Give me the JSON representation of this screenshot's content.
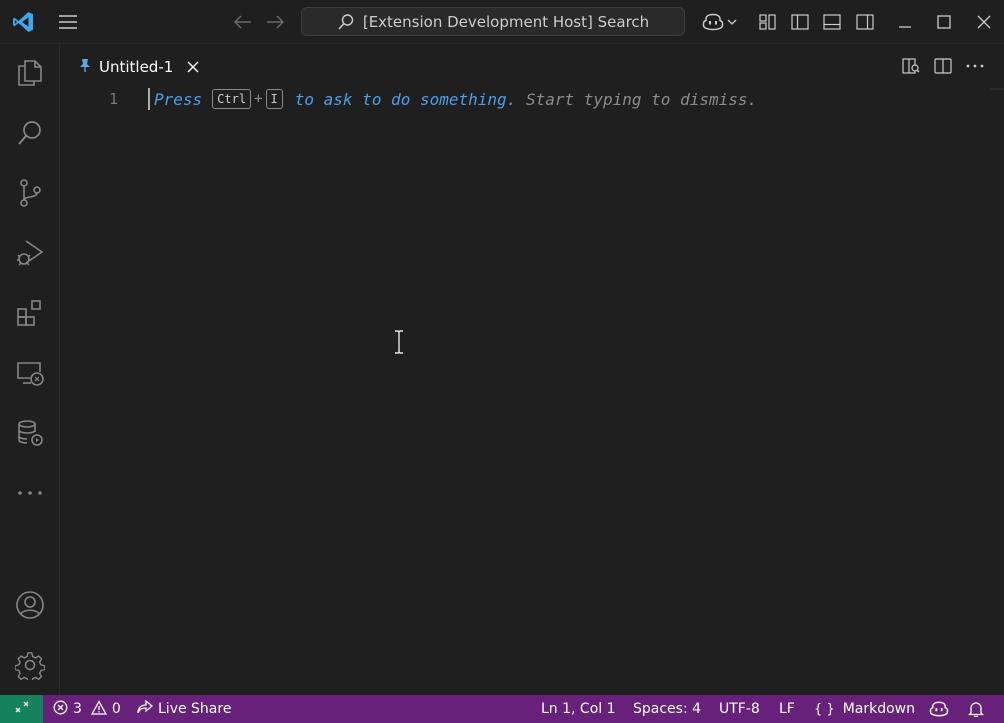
{
  "titlebar": {
    "search_text": "[Extension Development Host] Search"
  },
  "tab": {
    "label": "Untitled-1"
  },
  "editor": {
    "line_number": "1",
    "hint_press": "Press",
    "hint_key_ctrl": "Ctrl",
    "hint_plus": "+",
    "hint_key_i": "I",
    "hint_action": "to ask to do something",
    "hint_rest": ". Start typing to dismiss."
  },
  "statusbar": {
    "errors": "3",
    "warnings": "0",
    "live_share": "Live Share",
    "position": "Ln 1, Col 1",
    "spaces": "Spaces: 4",
    "encoding": "UTF-8",
    "eol": "LF",
    "language_braces": "{ }",
    "language": "Markdown"
  },
  "colors": {
    "status_bar": "#68217a",
    "remote_indicator": "#16825d",
    "hint_blue": "#4a9fe8",
    "vscode_logo": "#3ea7f0"
  }
}
